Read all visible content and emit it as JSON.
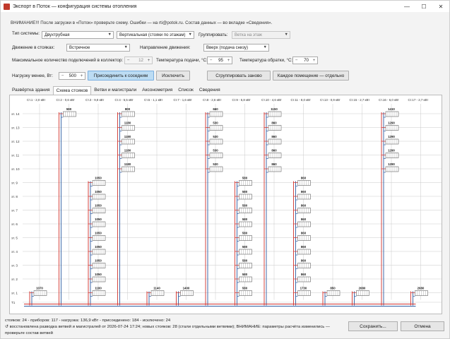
{
  "window": {
    "title": "Экспорт в Поток — конфигурация системы отопления"
  },
  "warning": "ВНИМАНИЕ!!! После загрузки в «Поток» проверьте схему. Ошибки — на rti@potok.ru. Состав данных — во вкладке «Сведения».",
  "form": {
    "system_type_label": "Тип системы:",
    "system_type_value": "Двухтрубная",
    "scheme_value": "Вертикальная (стояки по этажам)",
    "group_label": "Группировать:",
    "group_value": "Ветка на этаж",
    "risers_movement_label": "Движение в стояках:",
    "risers_movement_value": "Встречное",
    "direction_label": "Направление движения:",
    "direction_value": "Вверх (подача снизу)",
    "max_connections_label": "Максимальное количество подключений в коллектор:",
    "max_connections_value": "12",
    "supply_temp_label": "Температура подачи, °C:",
    "supply_temp_value": "95",
    "return_temp_label": "Температура обратки, °C:",
    "return_temp_value": "70",
    "load_below_label": "Нагрузку менее, Вт:",
    "load_below_value": "500",
    "attach_button": "Присоединить к соседним",
    "exclude_button": "Исключить",
    "regroup_button": "Сгруппировать заново",
    "each_room_button": "Каждое помещение — отдельно"
  },
  "tabs": [
    "Развёртка здания",
    "Схема стояков",
    "Ветви и магистрали",
    "Аксонометрия",
    "Список",
    "Сведения"
  ],
  "active_tab_index": 1,
  "colors": {
    "supply": "#d0312d",
    "return": "#2c5aa0",
    "accent": "#bcdcf3",
    "grid": "#c9c9c9"
  },
  "scheme": {
    "floor_labels": [
      "эт. 14",
      "эт. 13",
      "эт. 12",
      "эт. 11",
      "эт. 10",
      "эт. 9",
      "эт. 8",
      "эт. 7",
      "эт. 6",
      "эт. 5",
      "эт. 4",
      "эт. 3",
      "эт. 2",
      "эт. 1",
      "Т1",
      "Т2"
    ],
    "riser_headers": [
      "Ст.1 - 2,0 кВт",
      "Ст.2 - 0,6 кВт",
      "Ст.3 - 9,8 кВт",
      "Ст.4 - 5,5 кВт",
      "Ст.5 - 1,1 кВт",
      "Ст.7 - 1,6 кВт",
      "Ст.8 - 2,6 кВт",
      "Ст.9 - 5,8 кВт",
      "Ст.10 - 4,6 кВт",
      "Ст.11 - 8,0 кВт",
      "Ст.13 - 0,9 кВт",
      "Ст.15 - 2,7 кВт",
      "Ст.16 - 6,0 кВт",
      "Ст.17 - 2,7 кВт"
    ],
    "risers": [
      {
        "rads": [
          {
            "floor": 13,
            "power": "1070"
          }
        ]
      },
      {
        "rads": [
          {
            "floor": 0,
            "power": "590"
          }
        ]
      },
      {
        "rads": [
          {
            "floor": 5,
            "power": "1050"
          },
          {
            "floor": 6,
            "power": "1050"
          },
          {
            "floor": 7,
            "power": "1050"
          },
          {
            "floor": 8,
            "power": "1050"
          },
          {
            "floor": 9,
            "power": "1050"
          },
          {
            "floor": 10,
            "power": "1050"
          },
          {
            "floor": 11,
            "power": "1050"
          },
          {
            "floor": 12,
            "power": "1050"
          },
          {
            "floor": 13,
            "power": "1180"
          }
        ]
      },
      {
        "rads": [
          {
            "floor": 0,
            "power": "800"
          },
          {
            "floor": 1,
            "power": "1180"
          },
          {
            "floor": 2,
            "power": "1180"
          },
          {
            "floor": 3,
            "power": "1180"
          },
          {
            "floor": 4,
            "power": "1180"
          }
        ]
      },
      {
        "rads": [
          {
            "floor": 13,
            "power": "1140"
          }
        ]
      },
      {
        "rads": [
          {
            "floor": 13,
            "power": "1400"
          }
        ]
      },
      {
        "rads": [
          {
            "floor": 0,
            "power": "660"
          },
          {
            "floor": 1,
            "power": "530"
          },
          {
            "floor": 2,
            "power": "530"
          },
          {
            "floor": 3,
            "power": "530"
          },
          {
            "floor": 4,
            "power": "530"
          }
        ]
      },
      {
        "rads": [
          {
            "floor": 5,
            "power": "580"
          },
          {
            "floor": 6,
            "power": "580"
          },
          {
            "floor": 7,
            "power": "580"
          },
          {
            "floor": 8,
            "power": "580"
          },
          {
            "floor": 9,
            "power": "580"
          },
          {
            "floor": 10,
            "power": "580"
          },
          {
            "floor": 11,
            "power": "580"
          },
          {
            "floor": 12,
            "power": "580"
          },
          {
            "floor": 13,
            "power": "580"
          }
        ]
      },
      {
        "rads": [
          {
            "floor": 0,
            "power": "1150"
          },
          {
            "floor": 1,
            "power": "860"
          },
          {
            "floor": 2,
            "power": "860"
          },
          {
            "floor": 3,
            "power": "860"
          },
          {
            "floor": 4,
            "power": "860"
          }
        ]
      },
      {
        "rads": [
          {
            "floor": 5,
            "power": "860"
          },
          {
            "floor": 6,
            "power": "860"
          },
          {
            "floor": 7,
            "power": "860"
          },
          {
            "floor": 8,
            "power": "860"
          },
          {
            "floor": 9,
            "power": "860"
          },
          {
            "floor": 10,
            "power": "860"
          },
          {
            "floor": 11,
            "power": "860"
          },
          {
            "floor": 12,
            "power": "860"
          },
          {
            "floor": 13,
            "power": "1730"
          }
        ]
      },
      {
        "rads": [
          {
            "floor": 13,
            "power": "850"
          }
        ]
      },
      {
        "rads": [
          {
            "floor": 13,
            "power": "2680"
          }
        ]
      },
      {
        "rads": [
          {
            "floor": 0,
            "power": "1410"
          },
          {
            "floor": 1,
            "power": "1290"
          },
          {
            "floor": 2,
            "power": "1290"
          },
          {
            "floor": 3,
            "power": "1290"
          },
          {
            "floor": 4,
            "power": "1290"
          }
        ]
      },
      {
        "rads": [
          {
            "floor": 13,
            "power": "2680"
          }
        ]
      }
    ]
  },
  "status": {
    "line1": "стояков: 24 - приборов: 117 - нагрузка: 136,9 кВт - присоединено: 184 - исключено: 24",
    "line2": "↺ восстановлена разводка ветвей и магистралей от 2026-07-24 17:24; новых стояков: 28 (стали отдельными ветвями); ВНИМАНИЕ: параметры расчёта изменились —",
    "line3": "проверьте состав ветвей"
  },
  "footer": {
    "save_button": "Сохранить...",
    "cancel_button": "Отмена"
  }
}
